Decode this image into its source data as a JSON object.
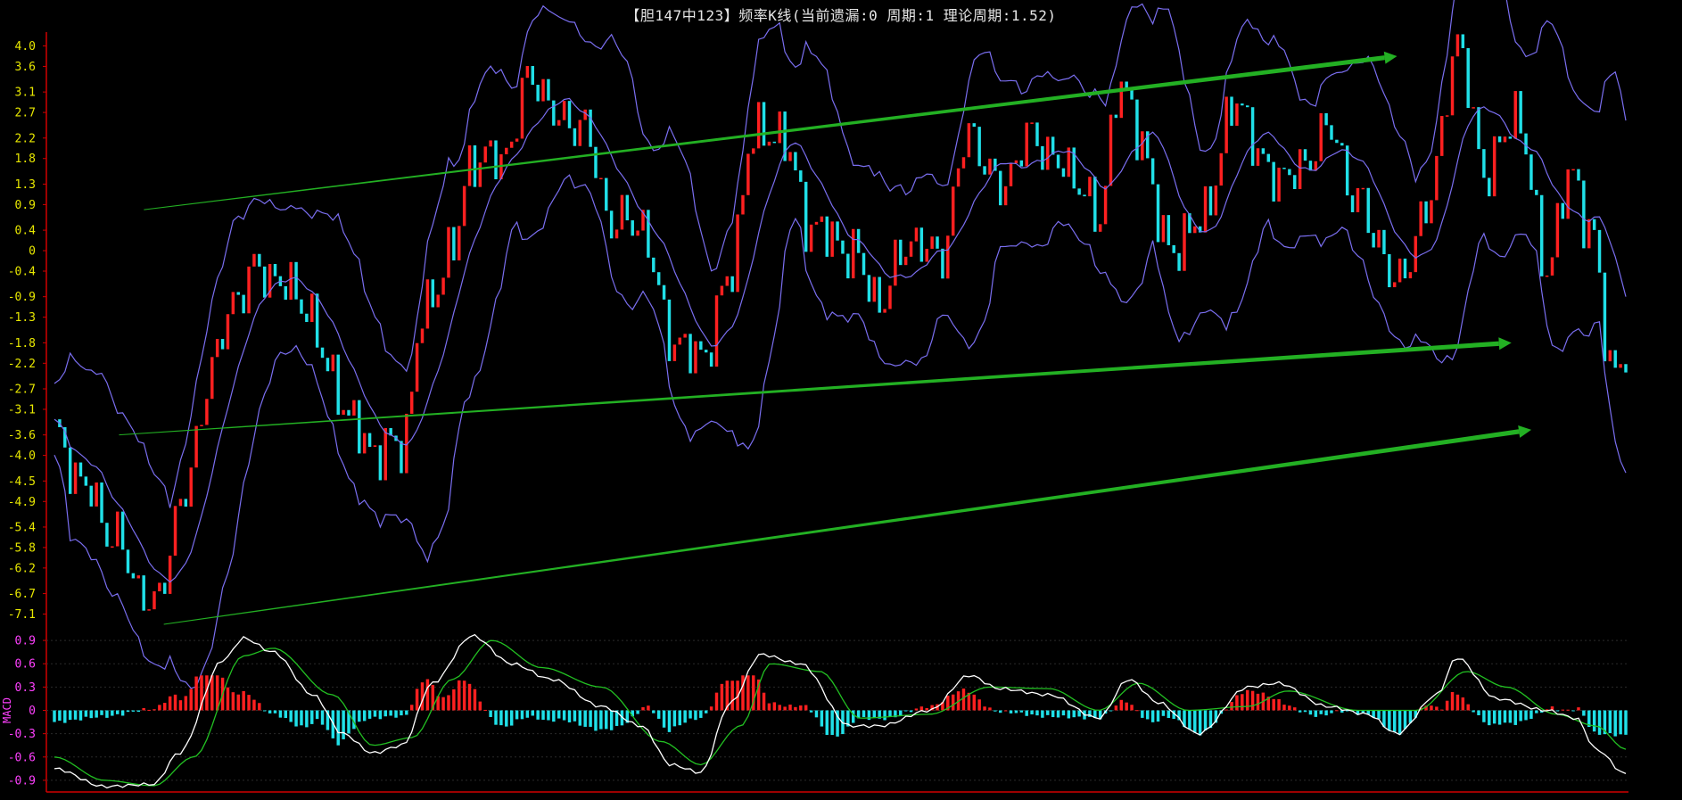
{
  "title": "【胆147中123】频率K线(当前遗漏:0 周期:1 理论周期:1.52)",
  "colors": {
    "background": "#000000",
    "axis": "#d00000",
    "main_tick_label": "#e8e800",
    "macd_tick_label": "#ff40ff",
    "up_candle": "#ff2020",
    "down_candle": "#20e0e8",
    "band": "#7a6ef0",
    "trend_arrow": "#23b023",
    "dif_line": "#ffffff",
    "dea_line": "#22c022"
  },
  "chart_data": [
    {
      "type": "candlestick",
      "title": "【胆147中123】频率K线(当前遗漏:0 周期:1 理论周期:1.52)",
      "y_ticks": [
        "4.0",
        "3.6",
        "3.1",
        "2.7",
        "2.2",
        "1.8",
        "1.3",
        "0.9",
        "0.4",
        "0",
        "-0.4",
        "-0.9",
        "-1.3",
        "-1.8",
        "-2.2",
        "-2.7",
        "-3.1",
        "-3.6",
        "-4.0",
        "-4.5",
        "-4.9",
        "-5.4",
        "-5.8",
        "-6.2",
        "-6.7",
        "-7.1"
      ],
      "ylim": [
        -7.3,
        4.2
      ],
      "candle_count": 300,
      "close_anchors": [
        [
          0,
          -3.6
        ],
        [
          6,
          -4.6
        ],
        [
          12,
          -5.6
        ],
        [
          18,
          -6.7
        ],
        [
          20,
          -7.0
        ],
        [
          26,
          -4.8
        ],
        [
          32,
          -2.2
        ],
        [
          36,
          -1.0
        ],
        [
          40,
          -0.4
        ],
        [
          44,
          -0.5
        ],
        [
          50,
          -1.0
        ],
        [
          56,
          -2.5
        ],
        [
          60,
          -3.4
        ],
        [
          64,
          -3.9
        ],
        [
          70,
          -3.8
        ],
        [
          74,
          -1.3
        ],
        [
          80,
          0.0
        ],
        [
          84,
          1.8
        ],
        [
          90,
          1.8
        ],
        [
          96,
          3.4
        ],
        [
          102,
          2.5
        ],
        [
          106,
          2.5
        ],
        [
          112,
          0.6
        ],
        [
          118,
          0.5
        ],
        [
          124,
          -1.7
        ],
        [
          130,
          -2.1
        ],
        [
          136,
          -0.5
        ],
        [
          140,
          2.2
        ],
        [
          146,
          2.3
        ],
        [
          152,
          0.5
        ],
        [
          160,
          0.0
        ],
        [
          166,
          -1.0
        ],
        [
          172,
          0.2
        ],
        [
          178,
          -0.1
        ],
        [
          184,
          2.3
        ],
        [
          190,
          1.2
        ],
        [
          196,
          2.2
        ],
        [
          206,
          1.4
        ],
        [
          210,
          0.5
        ],
        [
          214,
          3.3
        ],
        [
          218,
          2.3
        ],
        [
          224,
          0.0
        ],
        [
          230,
          0.5
        ],
        [
          238,
          2.9
        ],
        [
          244,
          1.5
        ],
        [
          250,
          1.5
        ],
        [
          256,
          2.4
        ],
        [
          262,
          1.0
        ],
        [
          266,
          0.2
        ],
        [
          270,
          -0.7
        ],
        [
          276,
          0.8
        ],
        [
          282,
          4.0
        ],
        [
          288,
          1.5
        ],
        [
          294,
          2.7
        ],
        [
          300,
          -0.3
        ],
        [
          305,
          1.5
        ],
        [
          309,
          0.4
        ],
        [
          313,
          -2.3
        ],
        [
          316,
          -2.0
        ]
      ],
      "bollinger_bands": [
        "upper",
        "middle",
        "lower"
      ],
      "trend_arrows": [
        {
          "from": [
            18,
            0.8
          ],
          "to": [
            270,
            3.8
          ]
        },
        {
          "from": [
            13,
            -3.6
          ],
          "to": [
            293,
            -1.8
          ]
        },
        {
          "from": [
            22,
            -7.3
          ],
          "to": [
            297,
            -3.5
          ]
        }
      ]
    },
    {
      "type": "line+bar",
      "label": "MACD",
      "y_ticks": [
        "0.9",
        "0.6",
        "0.3",
        "0",
        "-0.3",
        "-0.6",
        "-0.9"
      ],
      "ylim": [
        -1.05,
        1.05
      ],
      "series": [
        {
          "name": "DIF",
          "anchors": [
            [
              0,
              -0.75
            ],
            [
              10,
              -0.98
            ],
            [
              20,
              -0.95
            ],
            [
              25,
              -0.55
            ],
            [
              34,
              0.65
            ],
            [
              38,
              0.93
            ],
            [
              44,
              0.75
            ],
            [
              52,
              0.2
            ],
            [
              58,
              -0.3
            ],
            [
              64,
              -0.55
            ],
            [
              70,
              -0.45
            ],
            [
              76,
              0.35
            ],
            [
              84,
              0.96
            ],
            [
              92,
              0.6
            ],
            [
              100,
              0.4
            ],
            [
              110,
              0.05
            ],
            [
              118,
              -0.2
            ],
            [
              124,
              -0.7
            ],
            [
              130,
              -0.8
            ],
            [
              136,
              0.1
            ],
            [
              142,
              0.72
            ],
            [
              150,
              0.6
            ],
            [
              160,
              -0.2
            ],
            [
              166,
              -0.2
            ],
            [
              176,
              0.0
            ],
            [
              184,
              0.45
            ],
            [
              190,
              0.28
            ],
            [
              200,
              0.2
            ],
            [
              210,
              -0.1
            ],
            [
              216,
              0.4
            ],
            [
              222,
              0.1
            ],
            [
              230,
              -0.3
            ],
            [
              240,
              0.3
            ],
            [
              246,
              0.35
            ],
            [
              256,
              0.05
            ],
            [
              264,
              -0.05
            ],
            [
              270,
              -0.3
            ],
            [
              278,
              0.2
            ],
            [
              282,
              0.68
            ],
            [
              290,
              0.15
            ],
            [
              300,
              0.0
            ],
            [
              306,
              -0.1
            ],
            [
              310,
              -0.5
            ],
            [
              316,
              -0.82
            ]
          ]
        },
        {
          "name": "DEA",
          "anchors": [
            [
              0,
              -0.6
            ],
            [
              10,
              -0.9
            ],
            [
              20,
              -0.97
            ],
            [
              28,
              -0.6
            ],
            [
              38,
              0.7
            ],
            [
              44,
              0.8
            ],
            [
              56,
              0.2
            ],
            [
              64,
              -0.45
            ],
            [
              72,
              -0.35
            ],
            [
              80,
              0.4
            ],
            [
              88,
              0.9
            ],
            [
              98,
              0.55
            ],
            [
              110,
              0.3
            ],
            [
              122,
              -0.4
            ],
            [
              130,
              -0.7
            ],
            [
              138,
              -0.2
            ],
            [
              144,
              0.6
            ],
            [
              154,
              0.5
            ],
            [
              162,
              -0.1
            ],
            [
              176,
              -0.05
            ],
            [
              188,
              0.3
            ],
            [
              200,
              0.28
            ],
            [
              210,
              0.0
            ],
            [
              218,
              0.35
            ],
            [
              228,
              0.0
            ],
            [
              240,
              0.05
            ],
            [
              248,
              0.25
            ],
            [
              262,
              0.0
            ],
            [
              274,
              0.0
            ],
            [
              284,
              0.5
            ],
            [
              292,
              0.3
            ],
            [
              302,
              -0.05
            ],
            [
              310,
              -0.2
            ],
            [
              316,
              -0.5
            ]
          ]
        }
      ],
      "histogram": "MACD = 2 × (DIF − DEA); red above zero, cyan below"
    }
  ]
}
